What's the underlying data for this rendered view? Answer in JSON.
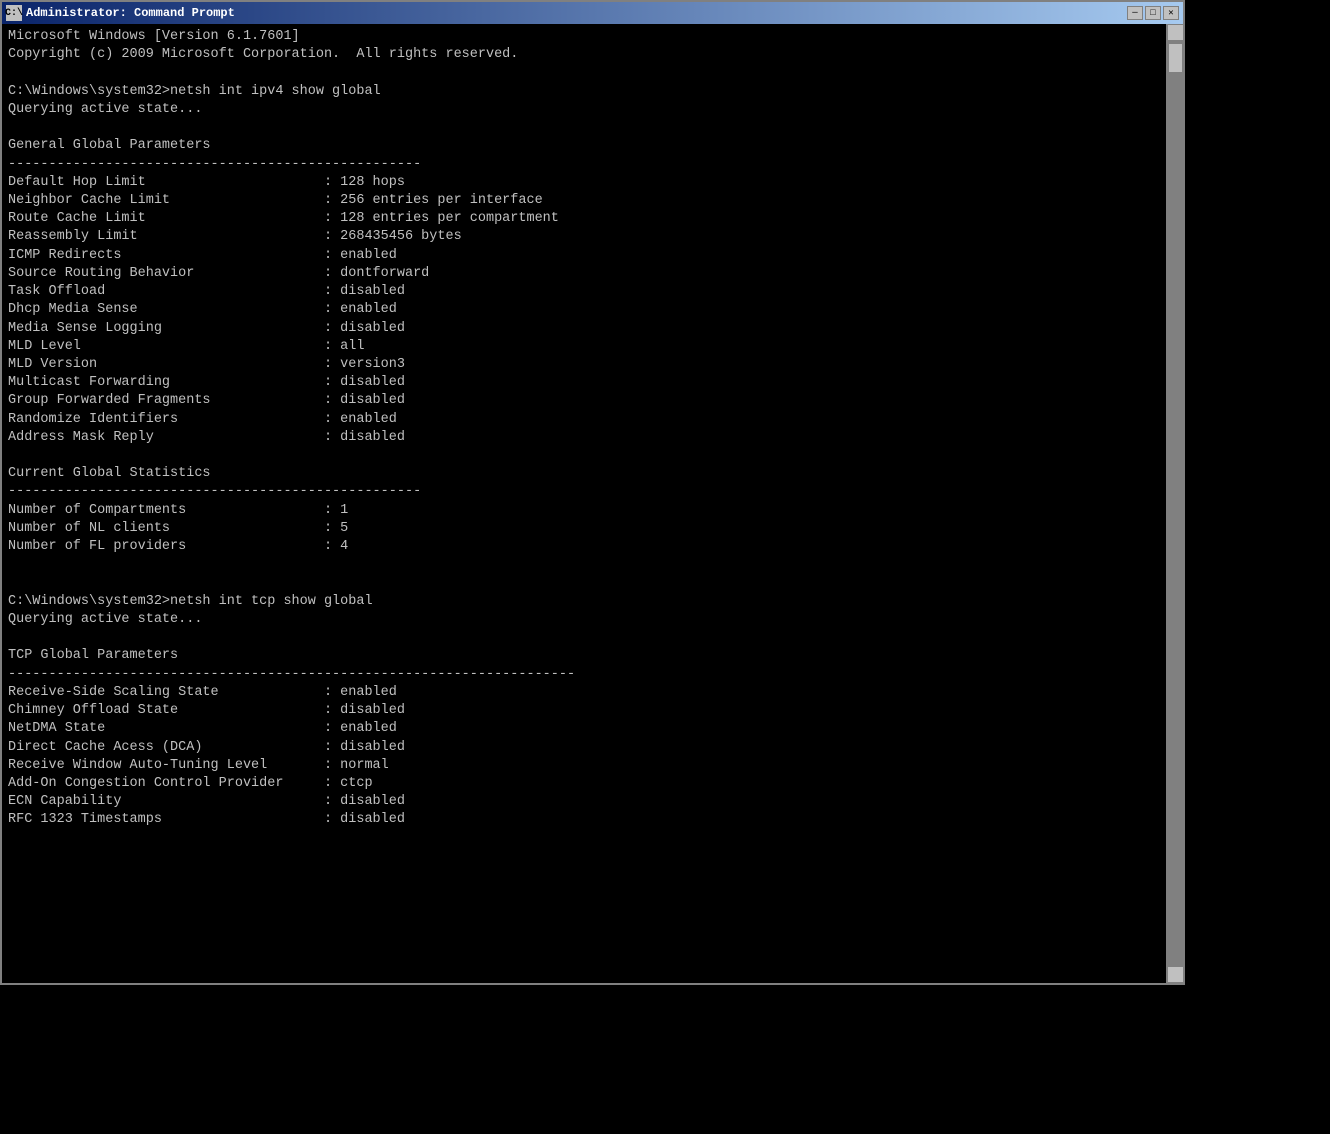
{
  "window": {
    "title": "Administrator: Command Prompt",
    "icon_label": "C:\\",
    "minimize_btn": "─",
    "maximize_btn": "□",
    "close_btn": "✕"
  },
  "terminal": {
    "content": "Microsoft Windows [Version 6.1.7601]\nCopyright (c) 2009 Microsoft Corporation.  All rights reserved.\n\nC:\\Windows\\system32>netsh int ipv4 show global\nQuerying active state...\n\nGeneral Global Parameters\n---------------------------------------------------\nDefault Hop Limit                      : 128 hops\nNeighbor Cache Limit                   : 256 entries per interface\nRoute Cache Limit                      : 128 entries per compartment\nReassembly Limit                       : 268435456 bytes\nICMP Redirects                         : enabled\nSource Routing Behavior                : dontforward\nTask Offload                           : disabled\nDhcp Media Sense                       : enabled\nMedia Sense Logging                    : disabled\nMLD Level                              : all\nMLD Version                            : version3\nMulticast Forwarding                   : disabled\nGroup Forwarded Fragments              : disabled\nRandomize Identifiers                  : enabled\nAddress Mask Reply                     : disabled\n\nCurrent Global Statistics\n---------------------------------------------------\nNumber of Compartments                 : 1\nNumber of NL clients                   : 5\nNumber of FL providers                 : 4\n\n\nC:\\Windows\\system32>netsh int tcp show global\nQuerying active state...\n\nTCP Global Parameters\n----------------------------------------------------------------------\nReceive-Side Scaling State             : enabled\nChimney Offload State                  : disabled\nNetDMA State                           : enabled\nDirect Cache Acess (DCA)               : disabled\nReceive Window Auto-Tuning Level       : normal\nAdd-On Congestion Control Provider     : ctcp\nECN Capability                         : disabled\nRFC 1323 Timestamps                    : disabled"
  }
}
